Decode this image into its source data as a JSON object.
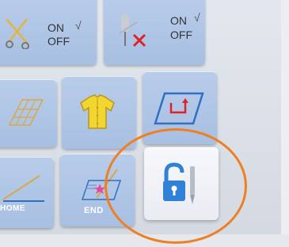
{
  "panel": {
    "top_row": {
      "thread_cut": {
        "icon": "scissors-icon",
        "on_label": "ON",
        "off_label": "OFF",
        "check": "√"
      },
      "needle": {
        "icon": "needle-x-icon",
        "on_label": "ON",
        "off_label": "OFF",
        "check": "√"
      }
    },
    "middle_row": {
      "grid_icon": "diamond-grid-icon",
      "shirt_icon": "shirt-icon",
      "frame_icon": "frame-move-icon"
    },
    "bottom_row": {
      "home": {
        "icon": "needle-home-icon",
        "label": "HOME"
      },
      "end": {
        "icon": "needle-end-icon",
        "label": "END"
      },
      "lock": {
        "icon": "unlock-needle-icon"
      }
    }
  },
  "colors": {
    "button_blue": "#b4c9e8",
    "highlight_orange": "#ef7f25",
    "accent_red": "#e0202a",
    "lock_blue": "#2f80d6"
  }
}
